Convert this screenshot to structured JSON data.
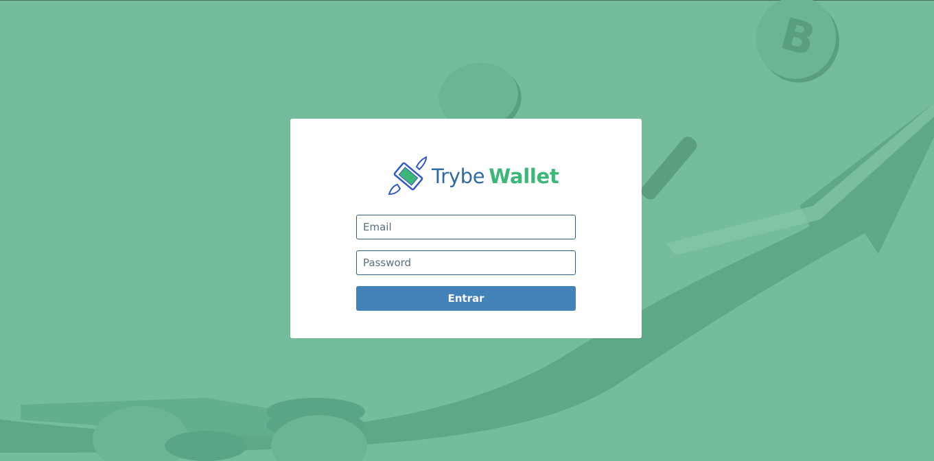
{
  "brand": {
    "name_part1": "Trybe",
    "name_part2": "Wallet",
    "colors": {
      "trybe": "#2f6aa3",
      "wallet": "#3bb878",
      "background": "#74bc9c",
      "button": "#4282b8"
    }
  },
  "login": {
    "email_placeholder": "Email",
    "email_value": "",
    "password_placeholder": "Password",
    "password_value": "",
    "submit_label": "Entrar"
  },
  "background_icons": [
    "bitcoin-coin-icon",
    "rising-arrow-graphic",
    "coin-stack-icon"
  ]
}
